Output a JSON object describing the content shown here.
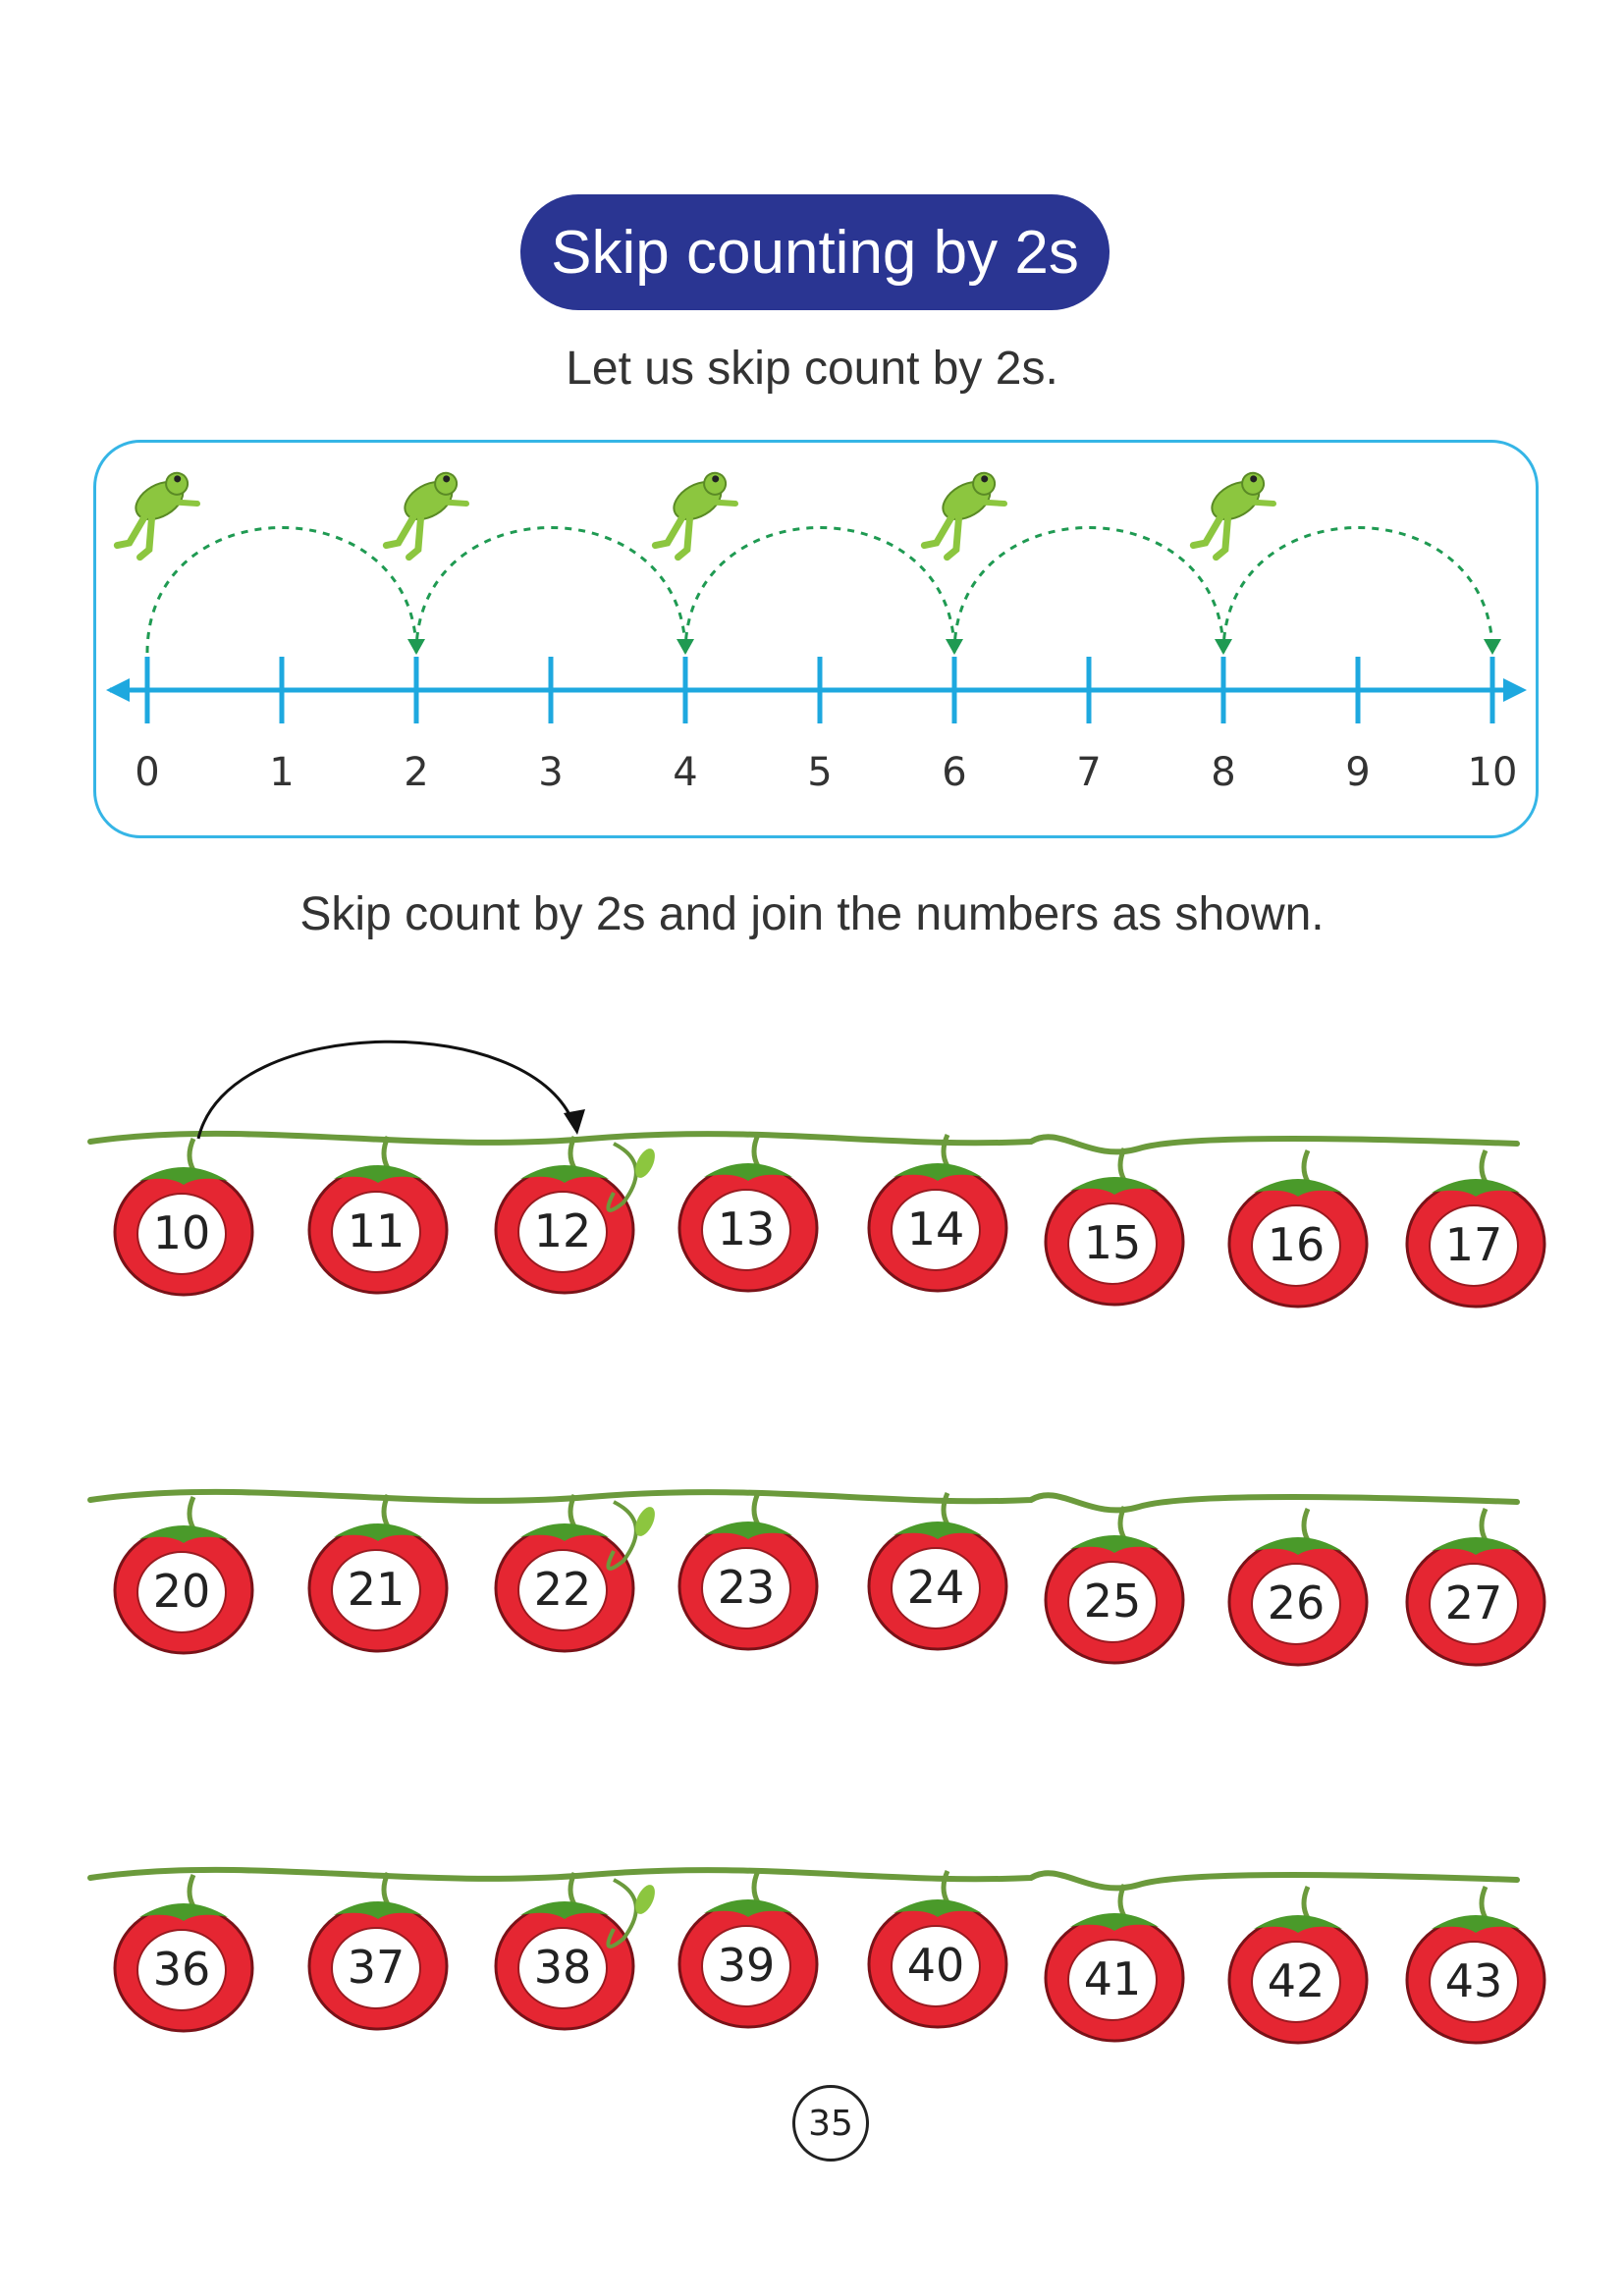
{
  "title": "Skip counting by 2s",
  "intro_text": "Let us skip count by 2s.",
  "number_line": {
    "labels": [
      "0",
      "1",
      "2",
      "3",
      "4",
      "5",
      "6",
      "7",
      "8",
      "9",
      "10"
    ],
    "jumps": [
      [
        0,
        2
      ],
      [
        2,
        4
      ],
      [
        4,
        6
      ],
      [
        6,
        8
      ],
      [
        8,
        10
      ]
    ]
  },
  "activity_instruction": "Skip count by 2s and join the numbers as shown.",
  "tomato_rows": [
    [
      "10",
      "11",
      "12",
      "13",
      "14",
      "15",
      "16",
      "17"
    ],
    [
      "20",
      "21",
      "22",
      "23",
      "24",
      "25",
      "26",
      "27"
    ],
    [
      "36",
      "37",
      "38",
      "39",
      "40",
      "41",
      "42",
      "43"
    ]
  ],
  "example_jump": [
    0,
    2
  ],
  "page_number": "35",
  "colors": {
    "title_bg": "#2a3592",
    "number_line": "#1ea8df",
    "box_border": "#35b5e6",
    "jump_arc": "#1f9a52",
    "tomato": "#e52632",
    "vine": "#6b9a3c",
    "frog": "#8cc63f"
  }
}
